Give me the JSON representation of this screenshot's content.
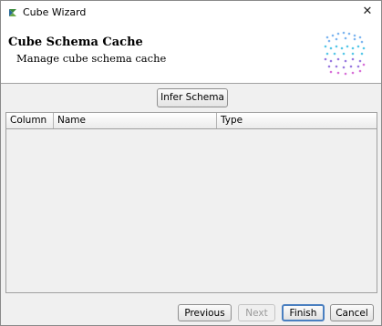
{
  "window": {
    "title": "Cube Wizard",
    "close_glyph": "✕"
  },
  "header": {
    "title": "Cube Schema Cache",
    "subtitle": "Manage cube schema cache",
    "logo_icon": "cube-wizard-logo-icon"
  },
  "toolbar": {
    "infer_label": "Infer Schema"
  },
  "table": {
    "columns": [
      "Column",
      "Name",
      "Type"
    ],
    "rows": []
  },
  "footer": {
    "previous_label": "Previous",
    "next_label": "Next",
    "finish_label": "Finish",
    "cancel_label": "Cancel"
  },
  "colors": {
    "default_button_border": "#4a7fc0",
    "panel_bg": "#f0f0f0"
  }
}
